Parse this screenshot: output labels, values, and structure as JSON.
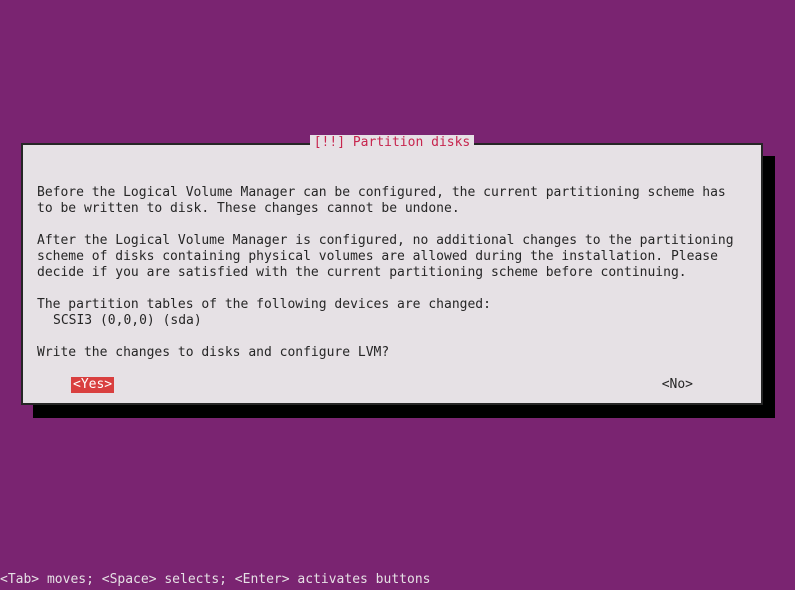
{
  "dialog": {
    "title": "[!!] Partition disks",
    "para1": "Before the Logical Volume Manager can be configured, the current partitioning scheme has to be written to disk. These changes cannot be undone.",
    "para2": "After the Logical Volume Manager is configured, no additional changes to the partitioning scheme of disks containing physical volumes are allowed during the installation. Please decide if you are satisfied with the current partitioning scheme before continuing.",
    "devices_header": "The partition tables of the following devices are changed:",
    "device1": "SCSI3 (0,0,0) (sda)",
    "question": "Write the changes to disks and configure LVM?",
    "yes_label": "<Yes>",
    "no_label": "<No>"
  },
  "hint": "<Tab> moves; <Space> selects; <Enter> activates buttons"
}
